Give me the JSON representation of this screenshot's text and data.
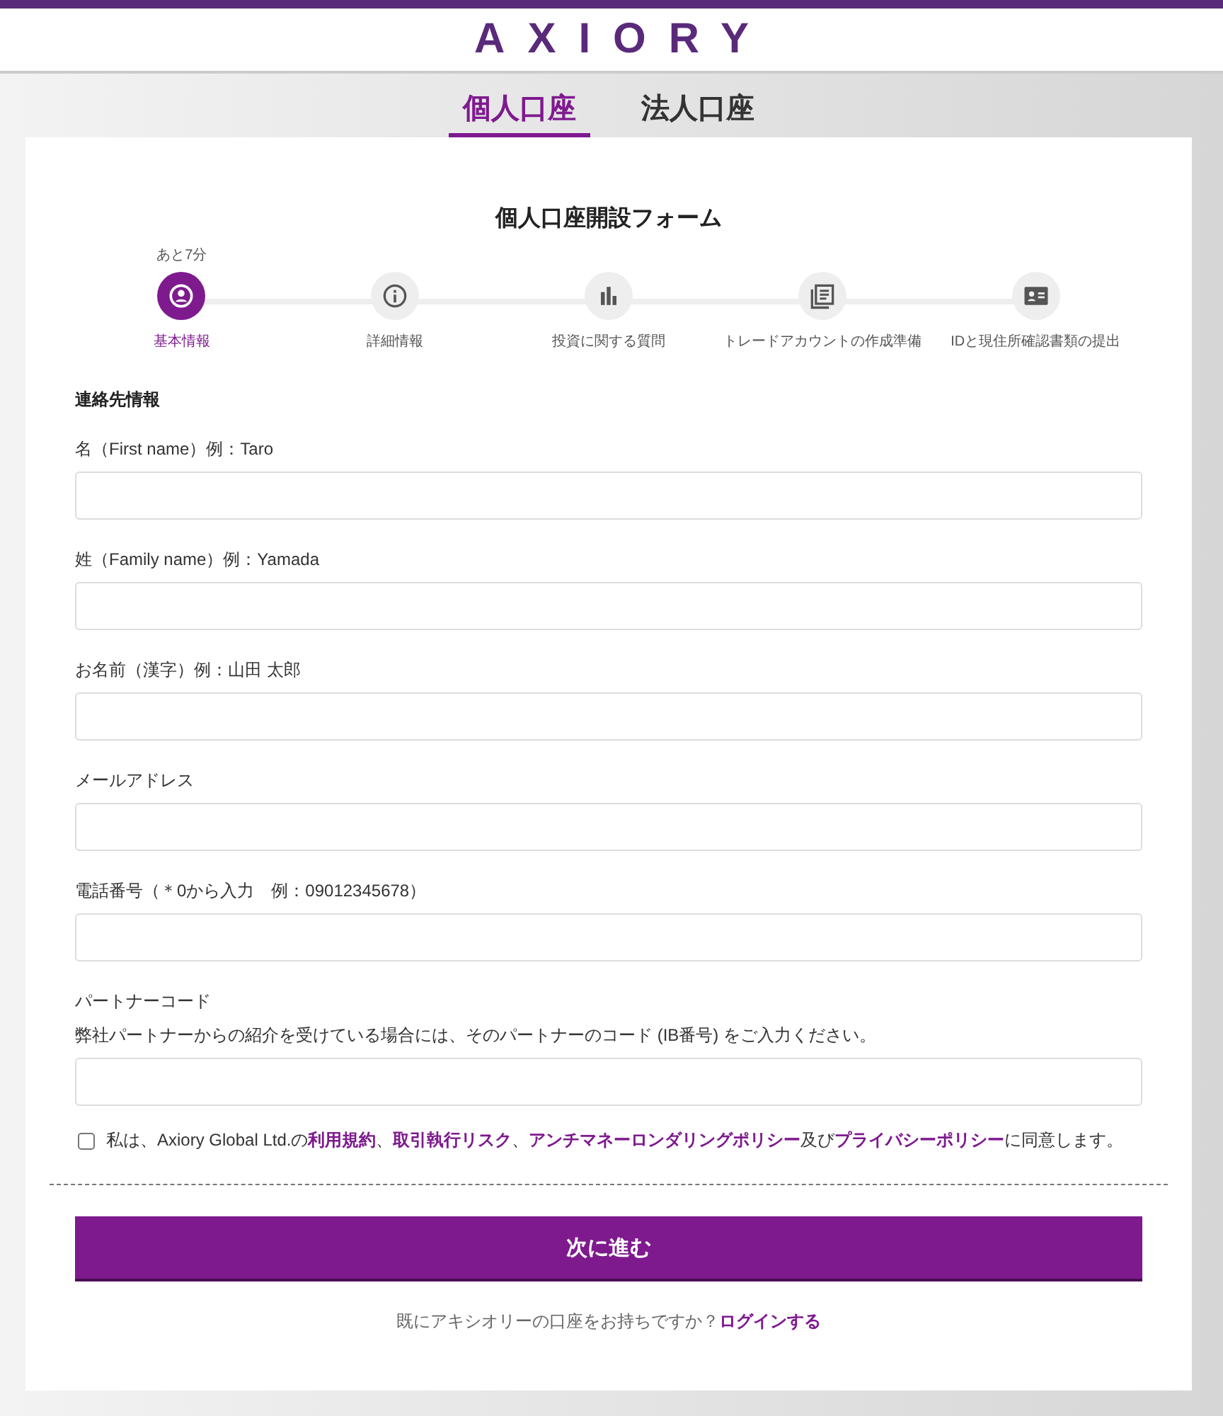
{
  "logo": "AXIORY",
  "tabs": [
    {
      "label": "個人口座",
      "selected": true
    },
    {
      "label": "法人口座",
      "selected": false
    }
  ],
  "form_title": "個人口座開設フォーム",
  "time_left": "あと7分",
  "steps": [
    {
      "kind": "person",
      "label": "基本情報",
      "selected": true
    },
    {
      "kind": "info",
      "label": "詳細情報",
      "selected": false
    },
    {
      "kind": "chart",
      "label": "投資に関する質問",
      "selected": false
    },
    {
      "kind": "document",
      "label": "トレードアカウントの作成準備",
      "selected": false
    },
    {
      "kind": "idcard",
      "label": "IDと現住所確認書類の提出",
      "selected": false
    }
  ],
  "section_title": "連絡先情報",
  "fields": [
    {
      "label": "名（First name）例：Taro"
    },
    {
      "label": "姓（Family name）例：Yamada"
    },
    {
      "label": "お名前（漢字）例：山田 太郎"
    },
    {
      "label": "メールアドレス"
    },
    {
      "label": "電話番号（＊0から入力　例：09012345678）"
    },
    {
      "label": "パートナーコード",
      "note": "弊社パートナーからの紹介を受けている場合には、そのパートナーのコード (IB番号) をご入力ください。"
    }
  ],
  "consent": {
    "checked": false,
    "parts": [
      {
        "kind": "text",
        "text": "私は、Axiory Global Ltd.の"
      },
      {
        "kind": "link",
        "text": "利用規約"
      },
      {
        "kind": "text",
        "text": "、"
      },
      {
        "kind": "link",
        "text": "取引執行リスク"
      },
      {
        "kind": "text",
        "text": "、"
      },
      {
        "kind": "link",
        "text": "アンチマネーロンダリングポリシー"
      },
      {
        "kind": "text",
        "text": "及び"
      },
      {
        "kind": "link",
        "text": "プライバシーポリシー"
      },
      {
        "kind": "text",
        "text": "に同意します。"
      }
    ]
  },
  "next_button": "次に進む",
  "login_prompt": "既にアキシオリーの口座をお持ちですか？",
  "login_link": "ログインする"
}
